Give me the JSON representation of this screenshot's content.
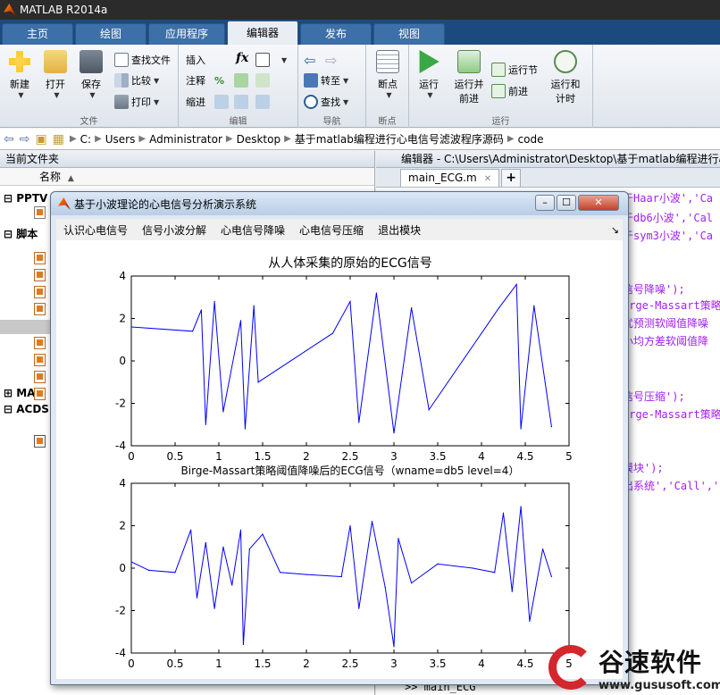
{
  "app": {
    "title": "MATLAB R2014a"
  },
  "ribbon_tabs": [
    {
      "label": "主页"
    },
    {
      "label": "绘图"
    },
    {
      "label": "应用程序"
    },
    {
      "label": "编辑器"
    },
    {
      "label": "发布"
    },
    {
      "label": "视图"
    }
  ],
  "ribbon": {
    "file": {
      "group": "文件",
      "new": "新建",
      "open": "打开",
      "save": "保存",
      "find_files": "查找文件",
      "compare": "比较",
      "print": "打印"
    },
    "edit": {
      "group": "编辑",
      "insert": "插入",
      "fx": "fx",
      "comment": "注释",
      "indent": "缩进"
    },
    "nav": {
      "group": "导航",
      "goto": "转至",
      "find": "查找"
    },
    "breakpoints": {
      "group": "断点",
      "label": "断点"
    },
    "run": {
      "group": "运行",
      "run": "运行",
      "run_advance": "运行并\n前进",
      "run_section": "运行节",
      "advance": "前进",
      "run_time": "运行和\n计时"
    }
  },
  "breadcrumb": [
    "C:",
    "Users",
    "Administrator",
    "Desktop",
    "基于matlab编程进行心电信号滤波程序源码",
    "code"
  ],
  "left_panel": {
    "title": "当前文件夹",
    "column_name": "名称",
    "sort_indicator": "▲",
    "nodes": [
      {
        "label": "PPTV"
      },
      {
        "label": "脚本"
      },
      {
        "label": "MAT"
      },
      {
        "label": "ACDS"
      }
    ]
  },
  "editor": {
    "title": "编辑器 - C:\\Users\\Administrator\\Desktop\\基于matlab编程进行心",
    "tab": "main_ECG.m",
    "code_lines": [
      "于Haar小波','Ca",
      "于db6小波','Cal",
      "于sym3小波','Ca",
      "信号降噪');",
      "irge-Massart策略",
      "优预测软阈值降噪",
      "小均方差软阈值降",
      "信号压缩');",
      "irge-Massart策略",
      "模块');",
      "出系统','Call','"
    ],
    "prompt": ">> main_ECG"
  },
  "figure": {
    "title": "基于小波理论的心电信号分析演示系统",
    "menu": [
      "认识心电信号",
      "信号小波分解",
      "心电信号降噪",
      "心电信号压缩",
      "退出模块"
    ],
    "menu_arrow": "↘"
  },
  "chart_data": [
    {
      "type": "line",
      "title": "从人体采集的原始的ECG信号",
      "xlim": [
        0,
        5
      ],
      "ylim": [
        -4,
        4
      ],
      "xticks": [
        "0",
        "0.5",
        "1",
        "1.5",
        "2",
        "2.5",
        "3",
        "3.5",
        "4",
        "4.5",
        "5"
      ],
      "yticks": [
        "4",
        "2",
        "0",
        "-2",
        "-4"
      ],
      "series": [
        {
          "color": "#0000ff",
          "x": [
            0.0,
            0.7,
            0.8,
            0.85,
            0.95,
            1.05,
            1.25,
            1.3,
            1.4,
            1.45,
            2.3,
            2.5,
            2.6,
            2.8,
            3.0,
            3.2,
            3.4,
            4.2,
            4.4,
            4.45,
            4.6,
            4.8
          ],
          "y": [
            1.6,
            1.4,
            2.4,
            -3.0,
            2.8,
            -2.4,
            1.9,
            -3.2,
            2.6,
            -1.0,
            1.3,
            2.8,
            -2.9,
            3.2,
            -3.4,
            2.5,
            -2.3,
            2.5,
            3.6,
            -3.2,
            2.6,
            -3.1
          ]
        }
      ],
      "grid": false
    },
    {
      "type": "line",
      "title": "Birge-Massart策略阈值降噪后的ECG信号（wname=db5 level=4）",
      "xlim": [
        0,
        5
      ],
      "ylim": [
        -4,
        4
      ],
      "xticks": [
        "0",
        "0.5",
        "1",
        "1.5",
        "2",
        "2.5",
        "3",
        "3.5",
        "4",
        "4.5",
        "5"
      ],
      "yticks": [
        "4",
        "2",
        "0",
        "-2",
        "-4"
      ],
      "series": [
        {
          "color": "#0000ff",
          "x": [
            0.0,
            0.2,
            0.5,
            0.68,
            0.75,
            0.85,
            0.95,
            1.05,
            1.15,
            1.25,
            1.28,
            1.35,
            1.5,
            1.7,
            2.0,
            2.4,
            2.5,
            2.6,
            2.75,
            2.9,
            3.0,
            3.05,
            3.2,
            3.5,
            3.9,
            4.15,
            4.25,
            4.35,
            4.45,
            4.55,
            4.7,
            4.8
          ],
          "y": [
            0.3,
            -0.1,
            -0.2,
            1.8,
            -1.4,
            1.2,
            -1.9,
            1.0,
            -0.8,
            1.8,
            -3.6,
            0.9,
            1.6,
            -0.2,
            -0.3,
            -0.4,
            2.0,
            -1.9,
            2.2,
            -0.9,
            -3.7,
            1.4,
            -0.7,
            0.2,
            0.0,
            -0.2,
            2.6,
            -1.1,
            2.9,
            -2.5,
            0.9,
            -0.4
          ]
        }
      ],
      "grid": false
    }
  ],
  "watermark": {
    "brand": "谷速软件",
    "url": "www.gususoft.com"
  },
  "colors": {
    "signal": "#0000ff",
    "ribbon_dark": "#1d4a7e",
    "tab_active": "#e9eef5",
    "code_purple": "#a020f0"
  }
}
